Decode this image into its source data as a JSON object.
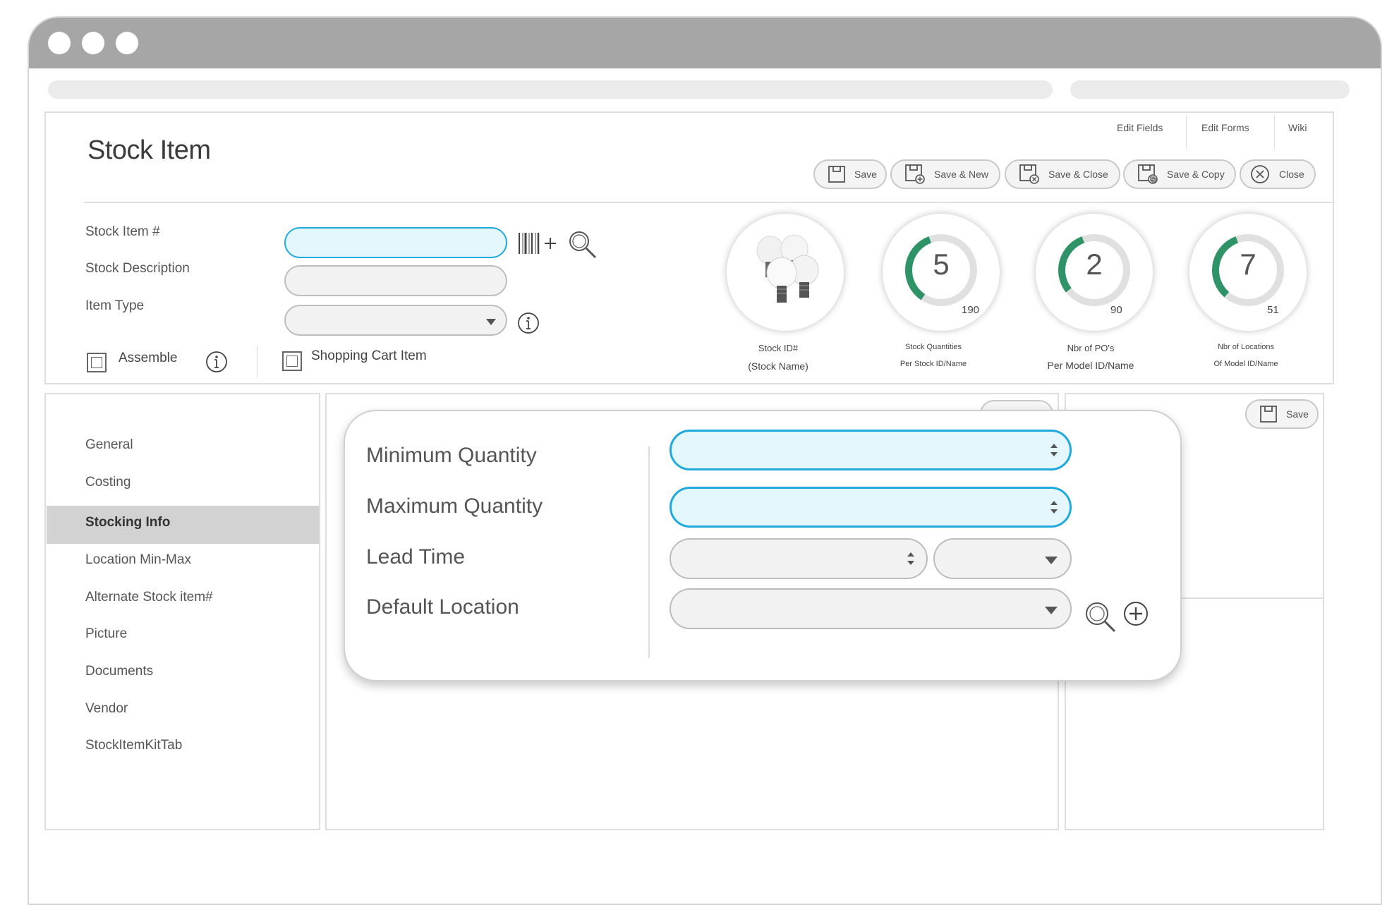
{
  "page": {
    "title": "Stock Item"
  },
  "top_links": [
    "Edit Fields",
    "Edit Forms",
    "Wiki"
  ],
  "toolbar": {
    "save": "Save",
    "save_new": "Save & New",
    "save_close": "Save & Close",
    "save_copy": "Save & Copy",
    "close": "Close"
  },
  "form": {
    "stock_item_label": "Stock Item #",
    "stock_description_label": "Stock Description",
    "item_type_label": "Item Type",
    "assemble_label": "Assemble",
    "shopping_cart_label": "Shopping Cart Item"
  },
  "kpis": {
    "stock": {
      "caption": "Stock ID#",
      "subcaption": "(Stock Name)"
    },
    "stock_quantities": {
      "value": "5",
      "total": "190",
      "progress": 0.35,
      "caption": "Stock Quantities",
      "subcaption": "Per Stock ID/Name"
    },
    "nbr_pos": {
      "value": "2",
      "total": "90",
      "progress": 0.3,
      "caption": "Nbr of PO's",
      "subcaption": "Per Model ID/Name"
    },
    "nbr_locations": {
      "value": "7",
      "total": "51",
      "progress": 0.33,
      "caption": "Nbr of Locations",
      "subcaption": "Of Model ID/Name"
    },
    "accent_color": "#2e9366"
  },
  "sidebar": {
    "items": [
      {
        "label": "General"
      },
      {
        "label": "Costing"
      },
      {
        "label": "Stocking Info",
        "active": true
      },
      {
        "label": "Location Min-Max"
      },
      {
        "label": "Alternate Stock item#"
      },
      {
        "label": "Picture"
      },
      {
        "label": "Documents"
      },
      {
        "label": "Vendor"
      },
      {
        "label": "StockItemKitTab"
      }
    ]
  },
  "right_panel": {
    "save_label": "Save"
  },
  "modal": {
    "minimum_quantity_label": "Minimum Quantity",
    "maximum_quantity_label": "Maximum Quantity",
    "lead_time_label": "Lead Time",
    "default_location_label": "Default Location"
  },
  "colors": {
    "focus": "#1fa9dd",
    "focus_fill": "#e3f7fd",
    "chrome": "#a6a6a6"
  }
}
